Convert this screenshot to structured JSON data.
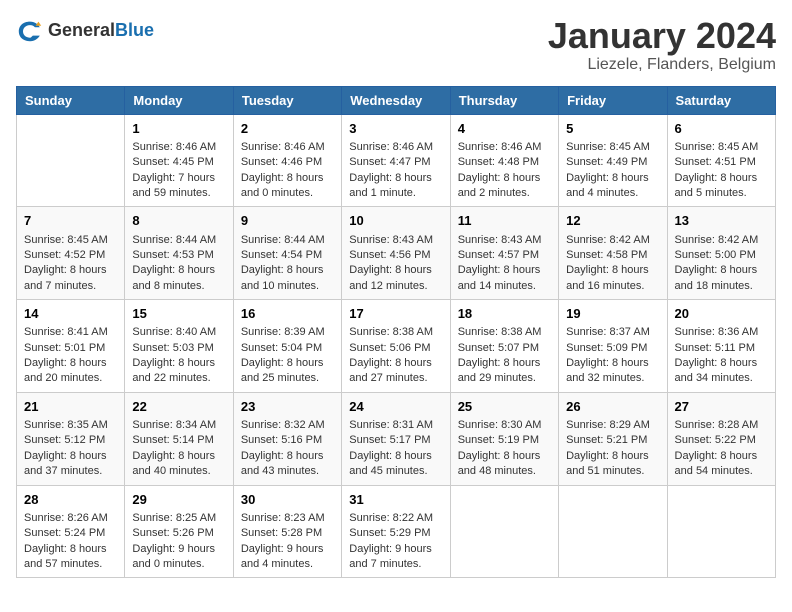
{
  "header": {
    "logo_general": "General",
    "logo_blue": "Blue",
    "title": "January 2024",
    "subtitle": "Liezele, Flanders, Belgium"
  },
  "columns": [
    "Sunday",
    "Monday",
    "Tuesday",
    "Wednesday",
    "Thursday",
    "Friday",
    "Saturday"
  ],
  "weeks": [
    [
      {
        "day": "",
        "detail": ""
      },
      {
        "day": "1",
        "detail": "Sunrise: 8:46 AM\nSunset: 4:45 PM\nDaylight: 7 hours\nand 59 minutes."
      },
      {
        "day": "2",
        "detail": "Sunrise: 8:46 AM\nSunset: 4:46 PM\nDaylight: 8 hours\nand 0 minutes."
      },
      {
        "day": "3",
        "detail": "Sunrise: 8:46 AM\nSunset: 4:47 PM\nDaylight: 8 hours\nand 1 minute."
      },
      {
        "day": "4",
        "detail": "Sunrise: 8:46 AM\nSunset: 4:48 PM\nDaylight: 8 hours\nand 2 minutes."
      },
      {
        "day": "5",
        "detail": "Sunrise: 8:45 AM\nSunset: 4:49 PM\nDaylight: 8 hours\nand 4 minutes."
      },
      {
        "day": "6",
        "detail": "Sunrise: 8:45 AM\nSunset: 4:51 PM\nDaylight: 8 hours\nand 5 minutes."
      }
    ],
    [
      {
        "day": "7",
        "detail": "Sunrise: 8:45 AM\nSunset: 4:52 PM\nDaylight: 8 hours\nand 7 minutes."
      },
      {
        "day": "8",
        "detail": "Sunrise: 8:44 AM\nSunset: 4:53 PM\nDaylight: 8 hours\nand 8 minutes."
      },
      {
        "day": "9",
        "detail": "Sunrise: 8:44 AM\nSunset: 4:54 PM\nDaylight: 8 hours\nand 10 minutes."
      },
      {
        "day": "10",
        "detail": "Sunrise: 8:43 AM\nSunset: 4:56 PM\nDaylight: 8 hours\nand 12 minutes."
      },
      {
        "day": "11",
        "detail": "Sunrise: 8:43 AM\nSunset: 4:57 PM\nDaylight: 8 hours\nand 14 minutes."
      },
      {
        "day": "12",
        "detail": "Sunrise: 8:42 AM\nSunset: 4:58 PM\nDaylight: 8 hours\nand 16 minutes."
      },
      {
        "day": "13",
        "detail": "Sunrise: 8:42 AM\nSunset: 5:00 PM\nDaylight: 8 hours\nand 18 minutes."
      }
    ],
    [
      {
        "day": "14",
        "detail": "Sunrise: 8:41 AM\nSunset: 5:01 PM\nDaylight: 8 hours\nand 20 minutes."
      },
      {
        "day": "15",
        "detail": "Sunrise: 8:40 AM\nSunset: 5:03 PM\nDaylight: 8 hours\nand 22 minutes."
      },
      {
        "day": "16",
        "detail": "Sunrise: 8:39 AM\nSunset: 5:04 PM\nDaylight: 8 hours\nand 25 minutes."
      },
      {
        "day": "17",
        "detail": "Sunrise: 8:38 AM\nSunset: 5:06 PM\nDaylight: 8 hours\nand 27 minutes."
      },
      {
        "day": "18",
        "detail": "Sunrise: 8:38 AM\nSunset: 5:07 PM\nDaylight: 8 hours\nand 29 minutes."
      },
      {
        "day": "19",
        "detail": "Sunrise: 8:37 AM\nSunset: 5:09 PM\nDaylight: 8 hours\nand 32 minutes."
      },
      {
        "day": "20",
        "detail": "Sunrise: 8:36 AM\nSunset: 5:11 PM\nDaylight: 8 hours\nand 34 minutes."
      }
    ],
    [
      {
        "day": "21",
        "detail": "Sunrise: 8:35 AM\nSunset: 5:12 PM\nDaylight: 8 hours\nand 37 minutes."
      },
      {
        "day": "22",
        "detail": "Sunrise: 8:34 AM\nSunset: 5:14 PM\nDaylight: 8 hours\nand 40 minutes."
      },
      {
        "day": "23",
        "detail": "Sunrise: 8:32 AM\nSunset: 5:16 PM\nDaylight: 8 hours\nand 43 minutes."
      },
      {
        "day": "24",
        "detail": "Sunrise: 8:31 AM\nSunset: 5:17 PM\nDaylight: 8 hours\nand 45 minutes."
      },
      {
        "day": "25",
        "detail": "Sunrise: 8:30 AM\nSunset: 5:19 PM\nDaylight: 8 hours\nand 48 minutes."
      },
      {
        "day": "26",
        "detail": "Sunrise: 8:29 AM\nSunset: 5:21 PM\nDaylight: 8 hours\nand 51 minutes."
      },
      {
        "day": "27",
        "detail": "Sunrise: 8:28 AM\nSunset: 5:22 PM\nDaylight: 8 hours\nand 54 minutes."
      }
    ],
    [
      {
        "day": "28",
        "detail": "Sunrise: 8:26 AM\nSunset: 5:24 PM\nDaylight: 8 hours\nand 57 minutes."
      },
      {
        "day": "29",
        "detail": "Sunrise: 8:25 AM\nSunset: 5:26 PM\nDaylight: 9 hours\nand 0 minutes."
      },
      {
        "day": "30",
        "detail": "Sunrise: 8:23 AM\nSunset: 5:28 PM\nDaylight: 9 hours\nand 4 minutes."
      },
      {
        "day": "31",
        "detail": "Sunrise: 8:22 AM\nSunset: 5:29 PM\nDaylight: 9 hours\nand 7 minutes."
      },
      {
        "day": "",
        "detail": ""
      },
      {
        "day": "",
        "detail": ""
      },
      {
        "day": "",
        "detail": ""
      }
    ]
  ]
}
